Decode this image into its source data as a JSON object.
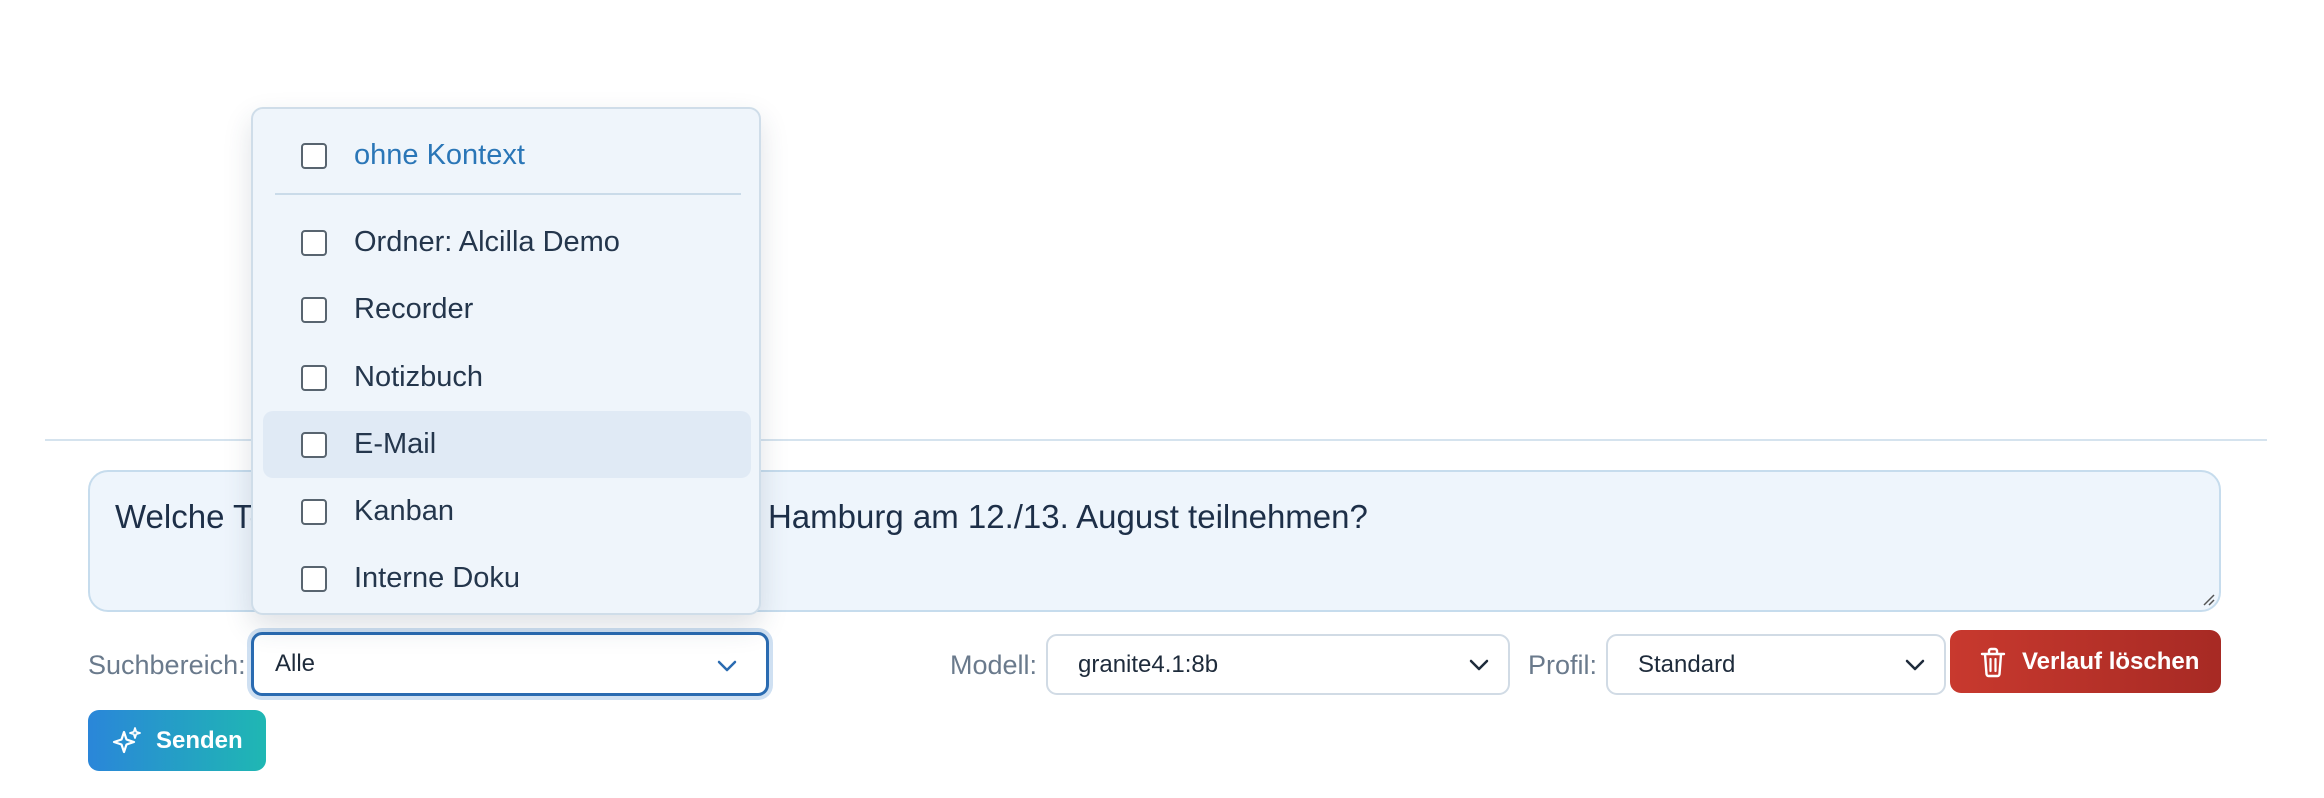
{
  "prompt": {
    "text": "Welche Teilnehmer werden am Workshop in Hamburg am 12./13. August teilnehmen?"
  },
  "search_scope": {
    "label": "Suchbereich:",
    "value": "Alle",
    "options": [
      {
        "label": "ohne Kontext",
        "checked": false
      },
      {
        "label": "Ordner: Alcilla Demo",
        "checked": false
      },
      {
        "label": "Recorder",
        "checked": false
      },
      {
        "label": "Notizbuch",
        "checked": false
      },
      {
        "label": "E-Mail",
        "checked": false
      },
      {
        "label": "Kanban",
        "checked": false
      },
      {
        "label": "Interne Doku",
        "checked": false
      }
    ]
  },
  "model": {
    "label": "Modell:",
    "value": "granite4.1:8b"
  },
  "profile": {
    "label": "Profil:",
    "value": "Standard"
  },
  "buttons": {
    "clear_history": "Verlauf löschen",
    "send": "Senden"
  },
  "icons": {
    "clear_history": "trash-icon",
    "send": "sparkles-icon",
    "select": "chevron-down-icon"
  },
  "colors": {
    "accent_blue": "#2a6bb1",
    "danger": "#c8392e",
    "send_gradient_start": "#2a86d9",
    "send_gradient_end": "#1fb7b3"
  }
}
